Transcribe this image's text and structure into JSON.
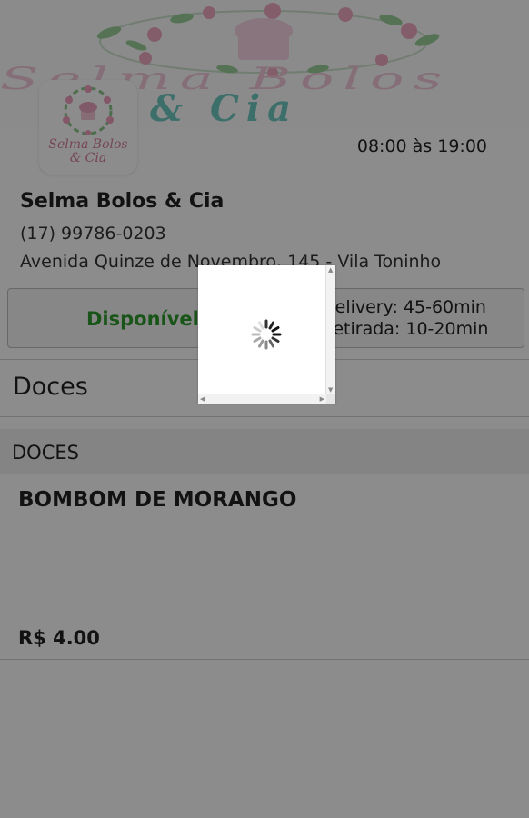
{
  "store": {
    "banner_title_line1": "Selma Bolos",
    "banner_title_line2": "& Cia",
    "logo_line1": "Selma Bolos",
    "logo_line2": "& Cia",
    "hours": "08:00 às 19:00",
    "name": "Selma Bolos & Cia",
    "phone": "(17) 99786-0203",
    "address": "Avenida Quinze de Novembro, 145 - Vila Toninho"
  },
  "status": {
    "label": "Disponível",
    "delivery_time": "Delivery: 45-60min",
    "pickup_time": "Retirada: 10-20min"
  },
  "menu": {
    "category_title": "Doces",
    "section_header": "DOCES",
    "products": [
      {
        "name": "BOMBOM DE MORANGO",
        "price": "R$ 4.00"
      }
    ]
  },
  "colors": {
    "available": "#2e9a2e",
    "brand_pink": "#d77fa3",
    "brand_teal": "#6ec8c2",
    "overlay": "rgba(0,0,0,0.45)"
  },
  "loading": {
    "icon": "spinner-icon"
  }
}
